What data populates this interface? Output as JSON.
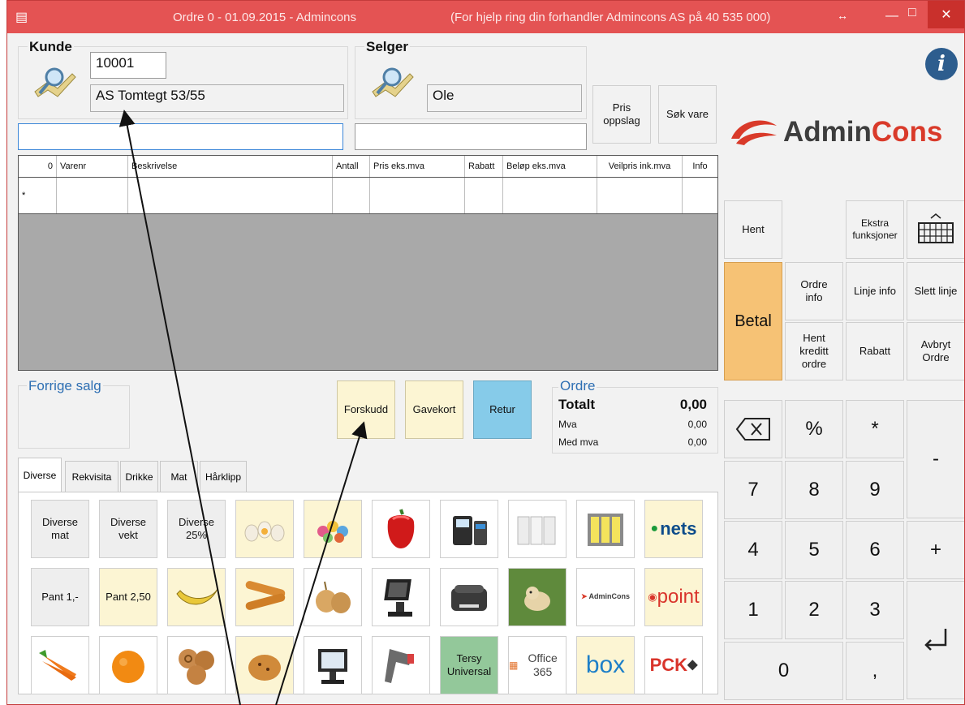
{
  "titlebar": {
    "title": "Ordre 0 - 01.09.2015 - Admincons",
    "help": "(For hjelp ring din forhandler Admincons AS på 40 535 000)"
  },
  "customer": {
    "label": "Kunde",
    "number": "10001",
    "name": "AS Tomtegt 53/55",
    "search_value": ""
  },
  "seller": {
    "label": "Selger",
    "name": "Ole",
    "search_value": ""
  },
  "toolbar": {
    "price_lookup": "Pris\noppslag",
    "search_item": "Søk vare"
  },
  "brand": {
    "part1": "Admin",
    "part2": "Cons",
    "color1": "#3d3d3d",
    "color2": "#d93a2a"
  },
  "grid": {
    "row_count": "0",
    "columns": [
      "Varenr",
      "Beskrivelse",
      "Antall",
      "Pris eks.mva",
      "Rabatt",
      "Beløp eks.mva",
      "Veilpris ink.mva",
      "Info"
    ],
    "new_row_marker": "*"
  },
  "history": {
    "label": "Forrige salg"
  },
  "actions": {
    "advance": "Forskudd",
    "giftcard": "Gavekort",
    "return": "Retur"
  },
  "order": {
    "label": "Ordre",
    "total_label": "Totalt",
    "total_value": "0,00",
    "vat_label": "Mva",
    "vat_value": "0,00",
    "incl_label": "Med mva",
    "incl_value": "0,00"
  },
  "tabs": [
    "Diverse",
    "Rekvisita",
    "Drikke",
    "Mat",
    "Hårklipp"
  ],
  "tiles": [
    {
      "label": "Diverse\nmat",
      "icon": "text"
    },
    {
      "label": "Diverse\nvekt",
      "icon": "text"
    },
    {
      "label": "Diverse\n25%",
      "icon": "text"
    },
    {
      "label": "",
      "icon": "eggs-icon"
    },
    {
      "label": "",
      "icon": "candy-icon"
    },
    {
      "label": "",
      "icon": "pepper-icon"
    },
    {
      "label": "",
      "icon": "card-terminal-icon"
    },
    {
      "label": "",
      "icon": "paper-rolls-icon"
    },
    {
      "label": "",
      "icon": "label-rolls-icon"
    },
    {
      "label": "nets",
      "icon": "nets-logo"
    },
    {
      "label": "Pant 1,-",
      "icon": "text"
    },
    {
      "label": "Pant 2,50",
      "icon": "text"
    },
    {
      "label": "",
      "icon": "banana-icon"
    },
    {
      "label": "",
      "icon": "baguette-icon"
    },
    {
      "label": "",
      "icon": "onion-icon"
    },
    {
      "label": "",
      "icon": "pos-terminal-icon"
    },
    {
      "label": "",
      "icon": "label-printer-icon"
    },
    {
      "label": "",
      "icon": "puppy-icon"
    },
    {
      "label": "AdminCons",
      "icon": "admincons-logo"
    },
    {
      "label": "point",
      "icon": "point-logo"
    },
    {
      "label": "",
      "icon": "carrot-icon"
    },
    {
      "label": "",
      "icon": "orange-icon"
    },
    {
      "label": "",
      "icon": "cinnamon-bun-icon"
    },
    {
      "label": "",
      "icon": "bun-icon"
    },
    {
      "label": "",
      "icon": "touchscreen-icon"
    },
    {
      "label": "",
      "icon": "barcode-scanner-icon"
    },
    {
      "label": "Tersy\nUniversal",
      "icon": "text"
    },
    {
      "label": "Office 365",
      "icon": "office365-logo"
    },
    {
      "label": "box",
      "icon": "box-logo"
    },
    {
      "label": "PCK",
      "icon": "pck-logo"
    }
  ],
  "side": {
    "fetch": "Hent",
    "extra": "Ekstra\nfunksjoner",
    "pay": "Betal",
    "order_info": "Ordre\ninfo",
    "line_info": "Linje info",
    "delete_line": "Slett linje",
    "fetch_credit": "Hent\nkreditt\nordre",
    "discount": "Rabatt",
    "cancel_order": "Avbryt\nOrdre"
  },
  "keypad": {
    "percent": "%",
    "multiply": "*",
    "minus": "-",
    "plus": "+",
    "k7": "7",
    "k8": "8",
    "k9": "9",
    "k4": "4",
    "k5": "5",
    "k6": "6",
    "k1": "1",
    "k2": "2",
    "k3": "3",
    "k0": "0",
    "comma": ","
  }
}
